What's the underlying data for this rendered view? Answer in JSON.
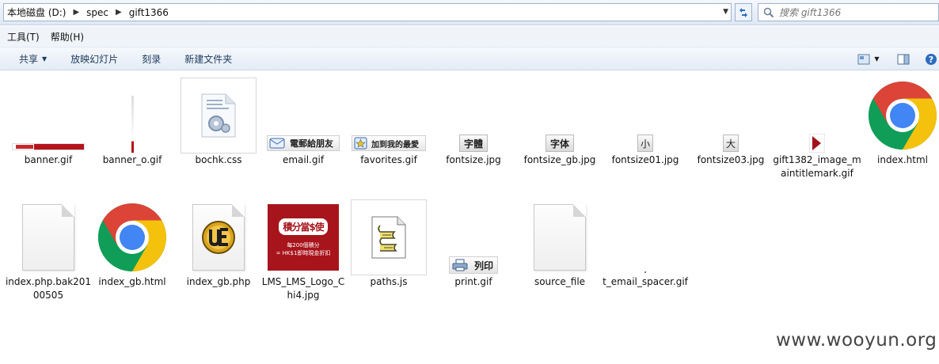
{
  "address": {
    "crumbs": [
      "本地磁盘 (D:)",
      "spec",
      "gift1366"
    ]
  },
  "search": {
    "placeholder": "搜索 gift1366"
  },
  "menu": {
    "items": [
      "工具(T)",
      "帮助(H)"
    ]
  },
  "commands": {
    "share": "共享",
    "slideshow": "放映幻灯片",
    "burn": "刻录",
    "new_folder": "新建文件夹"
  },
  "files": [
    {
      "name": "banner.gif"
    },
    {
      "name": "banner_o.gif"
    },
    {
      "name": "bochk.css"
    },
    {
      "name": "email.gif",
      "caption": "電郵給朋友"
    },
    {
      "name": "favorites.gif",
      "caption": "加到我的最愛"
    },
    {
      "name": "fontsize.jpg",
      "caption": "字體"
    },
    {
      "name": "fontsize_gb.jpg",
      "caption": "字体"
    },
    {
      "name": "fontsize01.jpg",
      "caption": "小"
    },
    {
      "name": "fontsize03.jpg",
      "caption": "大"
    },
    {
      "name": "gift1382_image_maintitlemark.gif"
    },
    {
      "name": "index.html"
    },
    {
      "name": "index.php.bak20100505"
    },
    {
      "name": "index_gb.html"
    },
    {
      "name": "index_gb.php"
    },
    {
      "name": "LMS_LMS_Logo_Chi4.jpg",
      "caption_lines": [
        "積分當$使",
        "每200個積分",
        "= HK$1即時現金折扣"
      ]
    },
    {
      "name": "paths.js"
    },
    {
      "name": "print.gif",
      "caption": "列印"
    },
    {
      "name": "source_file"
    },
    {
      "name": "t_email_spacer.gif"
    }
  ],
  "watermark": "www.wooyun.org",
  "colors": {
    "chrome_red": "#db4437",
    "chrome_yellow": "#f4c20d",
    "chrome_green": "#0f9d58",
    "chrome_blue": "#4285f4",
    "lms_red": "#a8141b"
  }
}
